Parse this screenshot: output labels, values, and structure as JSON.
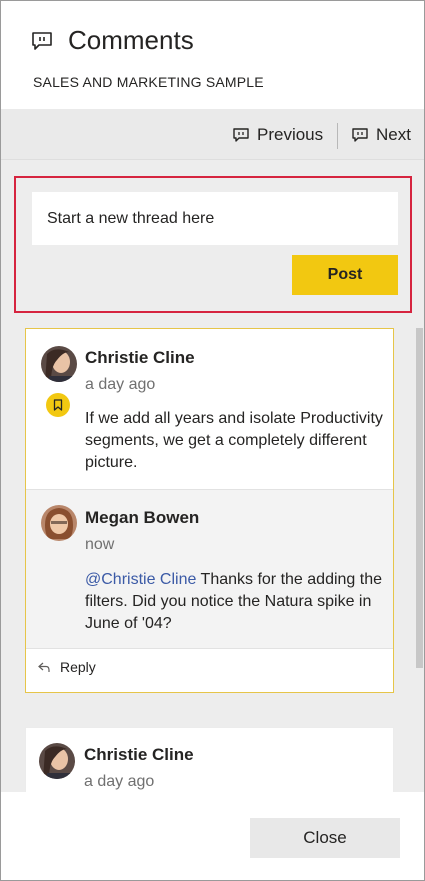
{
  "header": {
    "title": "Comments",
    "subtitle": "SALES AND MARKETING SAMPLE",
    "icon": "comment-icon"
  },
  "nav": {
    "previous_label": "Previous",
    "next_label": "Next",
    "icon": "comment-nav-icon"
  },
  "new_thread": {
    "placeholder": "Start a new thread here",
    "post_label": "Post"
  },
  "threads": [
    {
      "author": "Christie Cline",
      "time": "a day ago",
      "text": "If we add all years and isolate Productivity segments, we get a completely different picture.",
      "badge_icon": "bookmark-icon",
      "replies": [
        {
          "author": "Megan Bowen",
          "time": "now",
          "mention": "@Christie Cline",
          "text": " Thanks for the adding the filters. Did you notice the Natura spike in June of '04?"
        }
      ],
      "reply_label": "Reply"
    },
    {
      "author": "Christie Cline",
      "time": "a day ago"
    }
  ],
  "footer": {
    "close_label": "Close"
  },
  "colors": {
    "accent_yellow": "#f2c811",
    "highlight_border": "#d6243f",
    "mention": "#3b5aa6"
  }
}
